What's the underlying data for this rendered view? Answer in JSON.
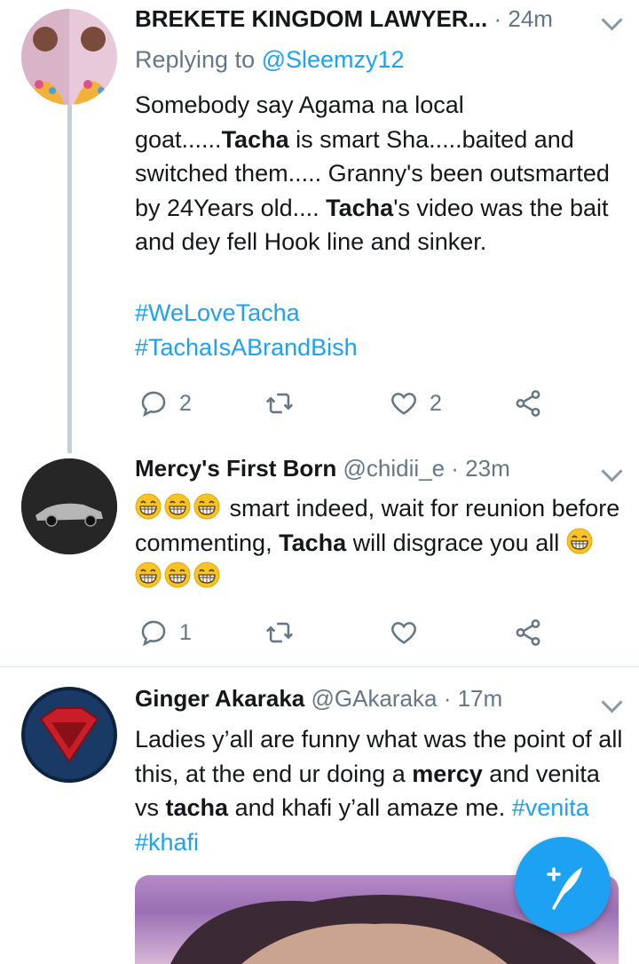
{
  "tweets": [
    {
      "name": "BREKETE KINGDOM LAWYER...",
      "time": "· 24m",
      "replying_label": "Replying to ",
      "replying_handle": "@Sleemzy12",
      "body": [
        {
          "t": "Somebody say Agama na local goat......"
        },
        {
          "t": "Tacha",
          "b": true
        },
        {
          "t": " is smart Sha.....baited and switched them..... Granny's been outsmarted by 24Years old.... "
        },
        {
          "t": "Tacha",
          "b": true
        },
        {
          "t": "'s video was the bait and dey fell Hook line and sinker."
        }
      ],
      "tag1": "#WeLoveTacha",
      "tag2": "#TachaIsABrandBish",
      "reply_count": "2",
      "like_count": "2"
    },
    {
      "name": "Mercy's First Born",
      "handle": "@chidii_e",
      "time": "· 23m",
      "text1": " smart indeed, wait for reunion before commenting, ",
      "bold1": "Tacha",
      "text2": " will disgrace you all ",
      "reply_count": "1"
    },
    {
      "name": "Ginger Akaraka",
      "handle": "@GAkaraka",
      "time": "· 17m",
      "text1": "Ladies y’all are funny what was the point of all this, at the end ur doing a ",
      "bold1": "mercy",
      "text2": " and venita vs ",
      "bold2": "tacha",
      "text3": " and khafi y’all amaze me. ",
      "tag1": "#venita",
      "tag2": "#khafi"
    }
  ],
  "colors": {
    "accent": "#1da1f2",
    "muted": "#657786",
    "text": "#14171a"
  },
  "icons": [
    "reply-icon",
    "retweet-icon",
    "like-icon",
    "share-icon",
    "compose-icon",
    "chevron-down-icon",
    "grinning-emoji"
  ]
}
